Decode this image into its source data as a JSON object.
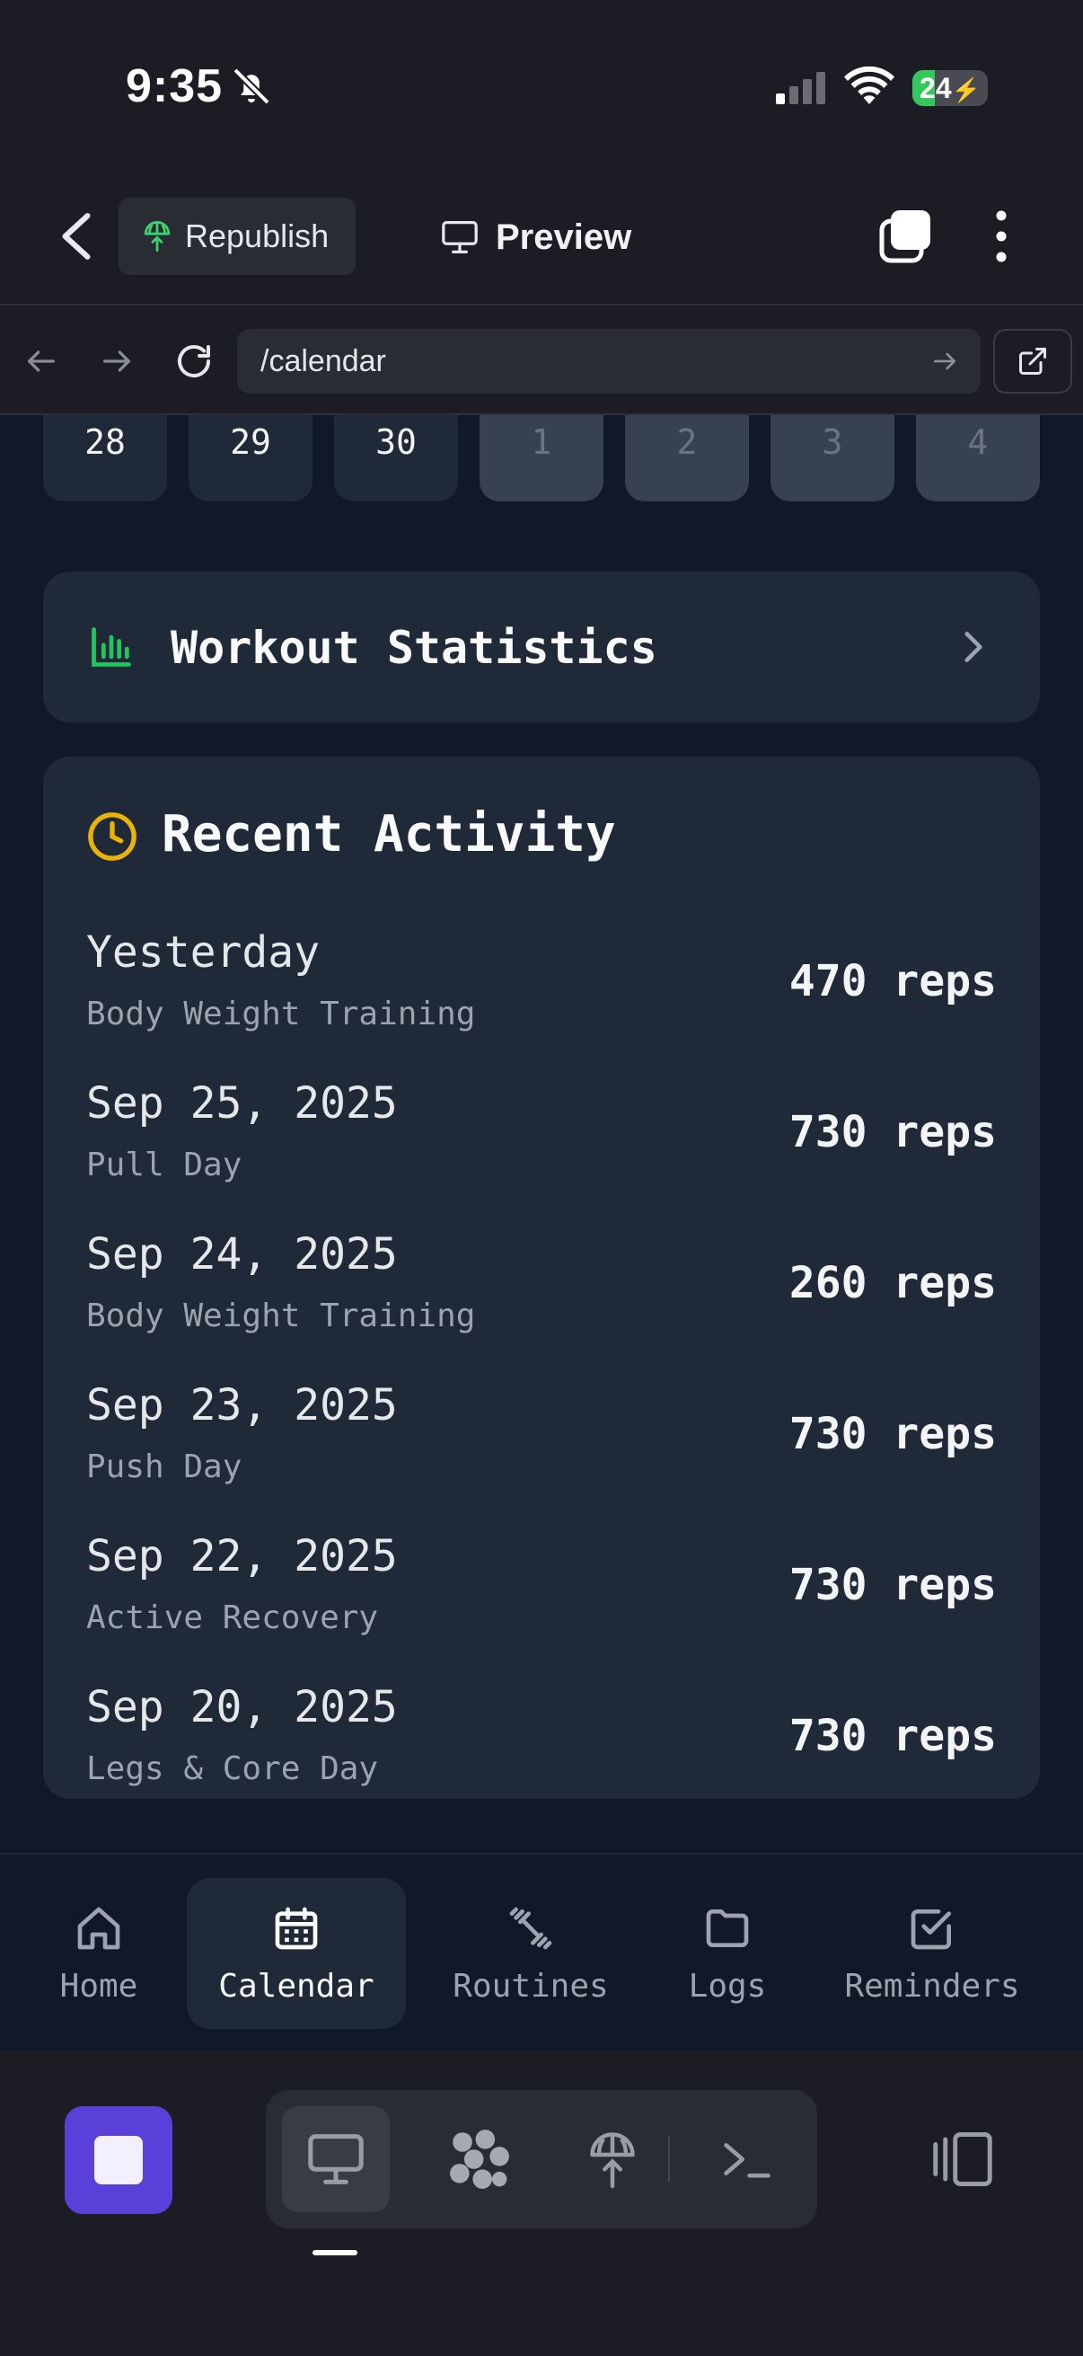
{
  "status_bar": {
    "time": "9:35",
    "battery": "24"
  },
  "header": {
    "republish_label": "Republish",
    "preview_label": "Preview"
  },
  "browser": {
    "url": "/calendar"
  },
  "calendar": {
    "days": [
      {
        "label": "28",
        "month": "current"
      },
      {
        "label": "29",
        "month": "current"
      },
      {
        "label": "30",
        "month": "current"
      },
      {
        "label": "1",
        "month": "next"
      },
      {
        "label": "2",
        "month": "next"
      },
      {
        "label": "3",
        "month": "next"
      },
      {
        "label": "4",
        "month": "next"
      }
    ]
  },
  "stats_card": {
    "title": "Workout Statistics",
    "accent": "#22c55e"
  },
  "activity": {
    "title": "Recent Activity",
    "accent": "#eab308",
    "items": [
      {
        "date": "Yesterday",
        "name": "Body Weight Training",
        "reps": "470 reps"
      },
      {
        "date": "Sep 25, 2025",
        "name": "Pull Day",
        "reps": "730 reps"
      },
      {
        "date": "Sep 24, 2025",
        "name": "Body Weight Training",
        "reps": "260 reps"
      },
      {
        "date": "Sep 23, 2025",
        "name": "Push Day",
        "reps": "730 reps"
      },
      {
        "date": "Sep 22, 2025",
        "name": "Active Recovery",
        "reps": "730 reps"
      },
      {
        "date": "Sep 20, 2025",
        "name": "Legs & Core Day",
        "reps": "730 reps"
      }
    ]
  },
  "nav": {
    "items": [
      {
        "label": "Home",
        "icon": "home-icon"
      },
      {
        "label": "Calendar",
        "icon": "calendar-icon",
        "active": true
      },
      {
        "label": "Routines",
        "icon": "dumbbell-icon"
      },
      {
        "label": "Logs",
        "icon": "folder-icon"
      },
      {
        "label": "Reminders",
        "icon": "check-square-icon"
      }
    ]
  },
  "colors": {
    "stop_button": "#5a3fd8",
    "battery_fill": "#34c759"
  }
}
